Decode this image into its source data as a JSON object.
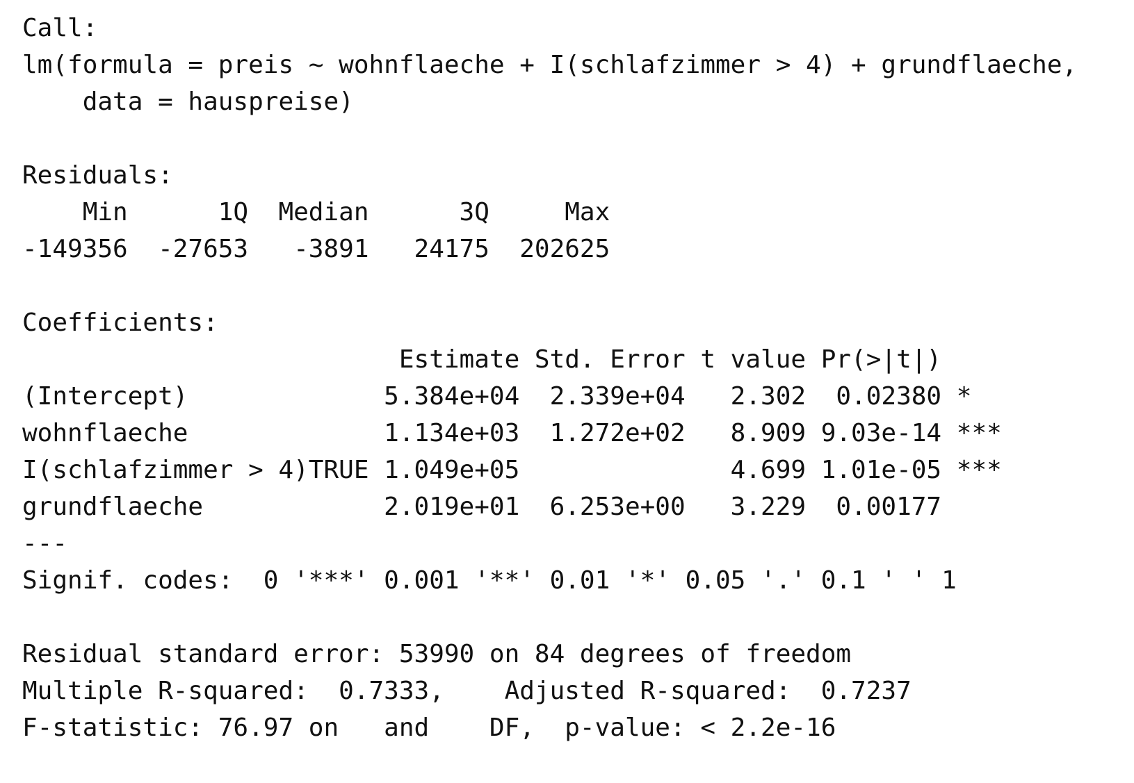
{
  "output": {
    "lines": [
      "Call:",
      "lm(formula = preis ~ wohnflaeche + I(schlafzimmer > 4) + grundflaeche,",
      "    data = hauspreise)",
      "",
      "Residuals:",
      "    Min      1Q  Median      3Q     Max",
      "-149356  -27653   -3891   24175  202625",
      "",
      "Coefficients:",
      "                         Estimate Std. Error t value Pr(>|t|)",
      "(Intercept)             5.384e+04  2.339e+04   2.302  0.02380 *",
      "wohnflaeche             1.134e+03  1.272e+02   8.909 9.03e-14 ***",
      "I(schlafzimmer > 4)TRUE 1.049e+05              4.699 1.01e-05 ***",
      "grundflaeche            2.019e+01  6.253e+00   3.229  0.00177",
      "---",
      "Signif. codes:  0 '***' 0.001 '**' 0.01 '*' 0.05 '.' 0.1 ' ' 1",
      "",
      "Residual standard error: 53990 on 84 degrees of freedom",
      "Multiple R-squared:  0.7333,    Adjusted R-squared:  0.7237",
      "F-statistic: 76.97 on   and    DF,  p-value: < 2.2e-16"
    ]
  }
}
